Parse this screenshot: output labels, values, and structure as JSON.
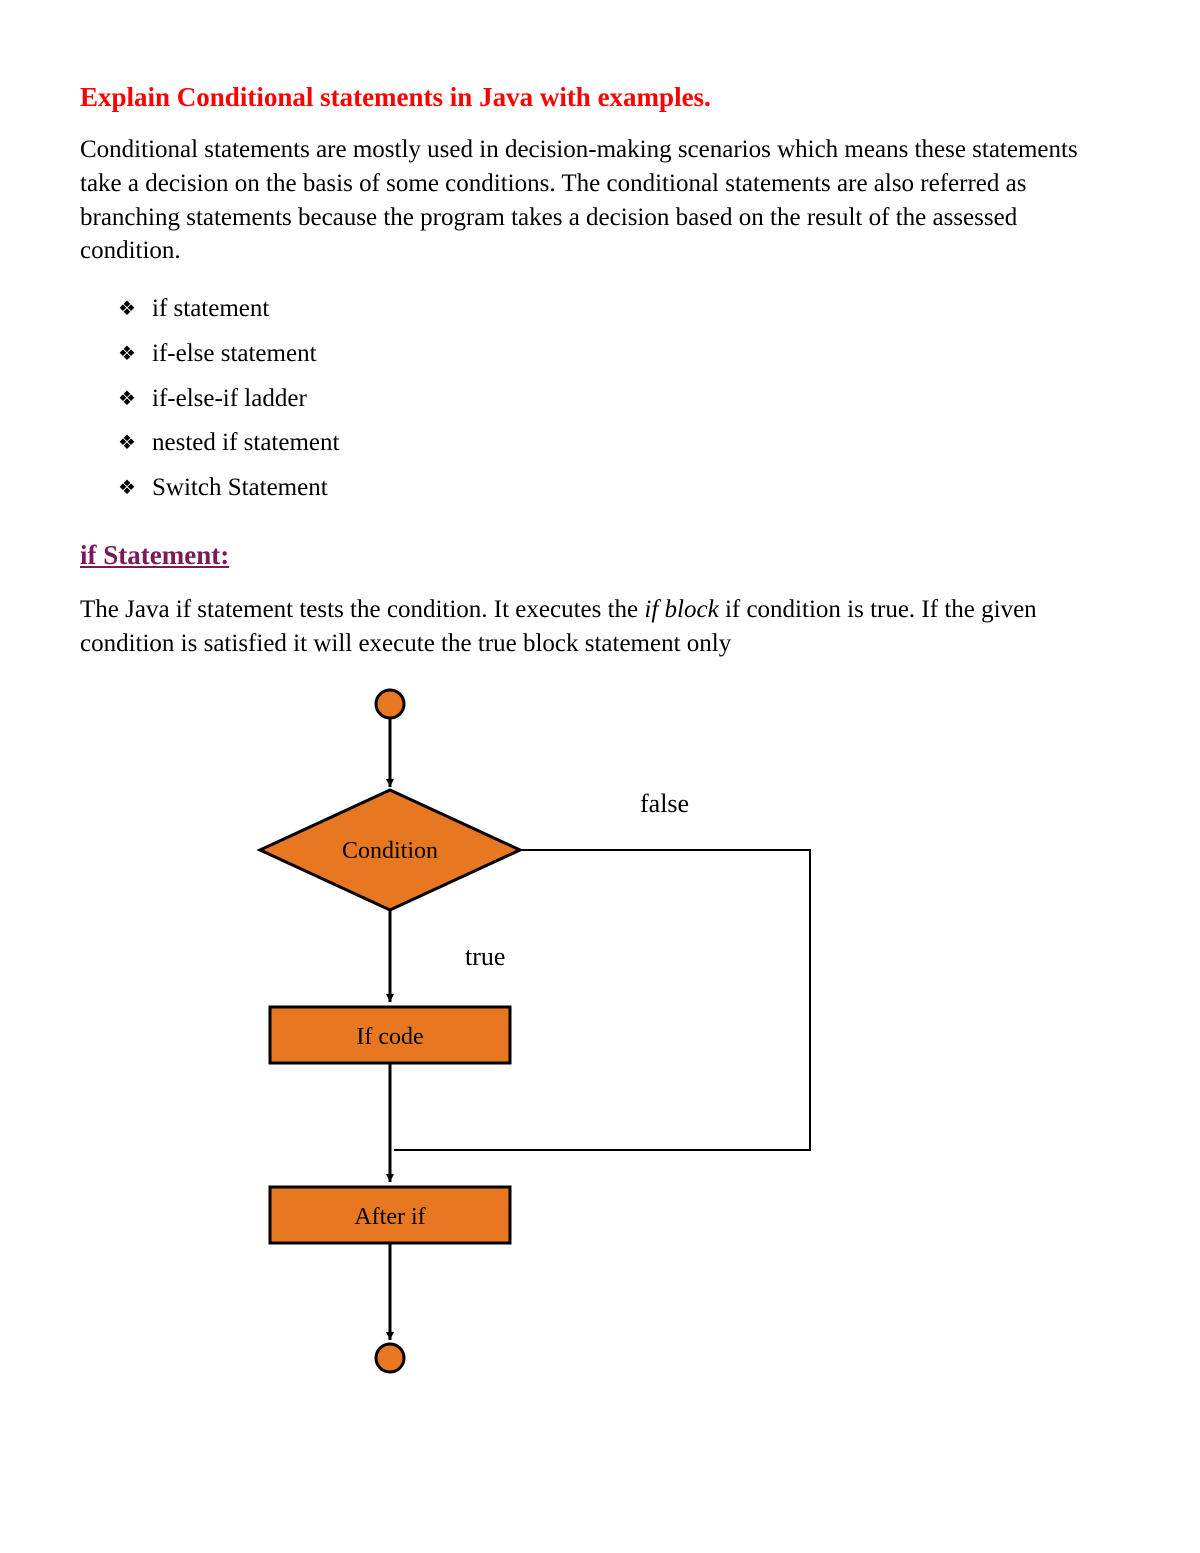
{
  "heading": "Explain Conditional statements in Java with examples.",
  "intro_paragraph": "Conditional statements are mostly used in decision-making scenarios which means these statements take a decision on the basis of some conditions. The conditional statements are also referred as branching statements because the program takes a decision based on the result of the assessed condition.",
  "bullet_items": [
    "if statement",
    "if-else statement",
    "if-else-if ladder",
    "nested if statement",
    "Switch Statement"
  ],
  "subheading": "if Statement:",
  "if_paragraph_part1": "The Java if statement tests the condition. It executes the ",
  "if_paragraph_emph": "if block",
  "if_paragraph_part2": " if condition is true. If the given condition is satisfied it will execute the true block statement only",
  "flowchart": {
    "condition_label": "Condition",
    "true_label": "true",
    "false_label": "false",
    "if_code_label": "If code",
    "after_if_label": "After if"
  }
}
